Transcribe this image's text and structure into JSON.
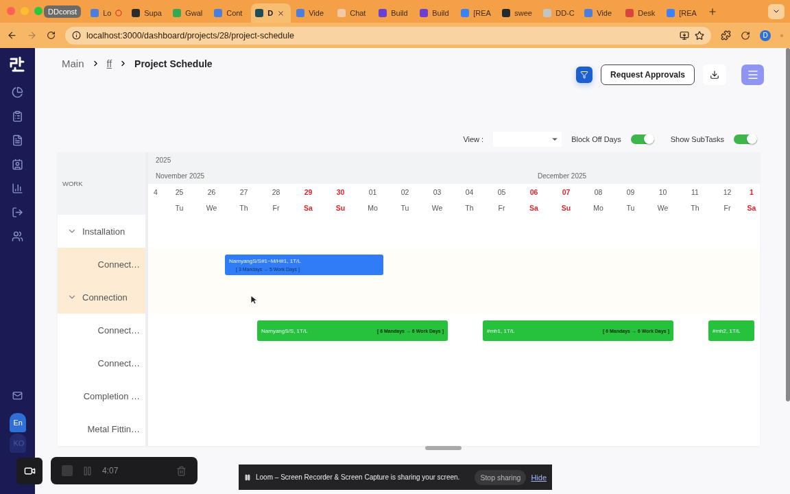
{
  "browser": {
    "tabs": [
      {
        "label": "DDconst",
        "kind": "group"
      },
      {
        "label": "Lo",
        "kind": "recording",
        "selected": false,
        "color": "#4a7fe0"
      },
      {
        "label": "Supa",
        "kind": "tab",
        "selected": false,
        "color": "#2b2b2b"
      },
      {
        "label": "Gwal",
        "kind": "tab",
        "selected": false,
        "color": "#34a853"
      },
      {
        "label": "Cont",
        "kind": "tab",
        "selected": false,
        "color": "#4a7fe0"
      },
      {
        "label": "D",
        "kind": "tab",
        "selected": true,
        "color": "#1d4d57"
      },
      {
        "label": "Vide",
        "kind": "tab",
        "selected": false,
        "color": "#4a7fe0"
      },
      {
        "label": "Chat",
        "kind": "tab",
        "selected": false,
        "color": "#f2c9a2"
      },
      {
        "label": "Build",
        "kind": "tab",
        "selected": false,
        "color": "#6b3fd0"
      },
      {
        "label": "Build",
        "kind": "tab",
        "selected": false,
        "color": "#6b3fd0"
      },
      {
        "label": "[REA",
        "kind": "tab",
        "selected": false,
        "color": "#3b82f6"
      },
      {
        "label": "swee",
        "kind": "tab",
        "selected": false,
        "color": "#24292e"
      },
      {
        "label": "DD-C",
        "kind": "tab",
        "selected": false,
        "color": "#c4c4c4"
      },
      {
        "label": "Vide",
        "kind": "tab",
        "selected": false,
        "color": "#4a7fe0"
      },
      {
        "label": "Desk",
        "kind": "tab",
        "selected": false,
        "color": "#d8453a"
      },
      {
        "label": "[REA",
        "kind": "tab",
        "selected": false,
        "color": "#3b82f6"
      }
    ],
    "url": "localhost:3000/dashboard/projects/28/project-schedule",
    "profile": "D"
  },
  "sidebar": {
    "languages": [
      {
        "label": "En",
        "selected": true
      },
      {
        "label": "KO",
        "selected": false
      }
    ]
  },
  "breadcrumb": [
    {
      "label": "Main",
      "kind": "plain"
    },
    {
      "label": "ff",
      "kind": "link"
    },
    {
      "label": "Project Schedule",
      "kind": "current"
    }
  ],
  "actions": {
    "request_button": "Request Approvals"
  },
  "toolbar": {
    "view_label": "View :",
    "block_off_days": {
      "label": "Block Off Days",
      "on": true
    },
    "show_subtasks": {
      "label": "Show SubTasks",
      "on": true
    }
  },
  "gantt": {
    "work_header": "WORK",
    "year": {
      "label": "2025",
      "months": [
        {
          "label": "November 2025",
          "days": [
            {
              "date": "4",
              "weekend": false
            },
            {
              "date": "25",
              "weekday": "Tu",
              "weekend": false
            },
            {
              "date": "26",
              "weekday": "We",
              "weekend": false
            },
            {
              "date": "27",
              "weekday": "Th",
              "weekend": false
            },
            {
              "date": "28",
              "weekday": "Fr",
              "weekend": false
            },
            {
              "date": "29",
              "weekday": "Sa",
              "weekend": true
            },
            {
              "date": "30",
              "weekday": "Su",
              "weekend": true
            }
          ]
        },
        {
          "label": "December 2025",
          "days": [
            {
              "date": "01",
              "weekday": "Mo",
              "weekend": false
            },
            {
              "date": "02",
              "weekday": "Tu",
              "weekend": false
            },
            {
              "date": "03",
              "weekday": "We",
              "weekend": false
            },
            {
              "date": "04",
              "weekday": "Th",
              "weekend": false
            },
            {
              "date": "05",
              "weekday": "Fr",
              "weekend": false
            },
            {
              "date": "06",
              "weekday": "Sa",
              "weekend": true
            },
            {
              "date": "07",
              "weekday": "Su",
              "weekend": true
            },
            {
              "date": "08",
              "weekday": "Mo",
              "weekend": false
            },
            {
              "date": "09",
              "weekday": "Tu",
              "weekend": false
            },
            {
              "date": "10",
              "weekday": "We",
              "weekend": false
            },
            {
              "date": "11",
              "weekday": "Th",
              "weekend": false
            },
            {
              "date": "12",
              "weekday": "Fr",
              "weekend": false
            },
            {
              "date": "1",
              "weekday": "Sa",
              "weekend": true
            }
          ]
        }
      ]
    },
    "rows": [
      {
        "label": "Installation",
        "kind": "group",
        "expanded": true,
        "selected": false
      },
      {
        "label": "Connect…",
        "kind": "task",
        "selected": true,
        "bars": [
          {
            "title": "NamyangS/S#1~M/H#1, 1T/L",
            "duration": "[ 3 Mandays → 5 Work Days ]",
            "kind": "stacked",
            "color": "#2f7cf6"
          }
        ]
      },
      {
        "label": "Connection",
        "kind": "group",
        "expanded": true,
        "selected": true
      },
      {
        "label": "Connect…",
        "kind": "task",
        "selected": false,
        "bars": [
          {
            "title": "NamyangS/S, 1T/L",
            "duration": "[ 6 Mandays → 6 Work Days ]",
            "kind": "inline",
            "color": "#26c23c"
          },
          {
            "title": "#mh1, 1T/L",
            "duration": "[ 6 Mandays → 6 Work Days ]",
            "kind": "inline",
            "color": "#26c23c"
          },
          {
            "title": "#mh2, 1T/L",
            "kind": "inline",
            "color": "#26c23c"
          }
        ]
      },
      {
        "label": "Connect…",
        "kind": "task",
        "selected": false
      },
      {
        "label": "Completion …",
        "kind": "task",
        "selected": false
      },
      {
        "label": "Metal Fittin…",
        "kind": "task",
        "selected": false
      }
    ]
  },
  "recorder": {
    "time": "4:07",
    "notice": "Loom – Screen Recorder & Screen Capture is sharing your screen.",
    "stop_button": "Stop sharing",
    "hide_link": "Hide"
  }
}
